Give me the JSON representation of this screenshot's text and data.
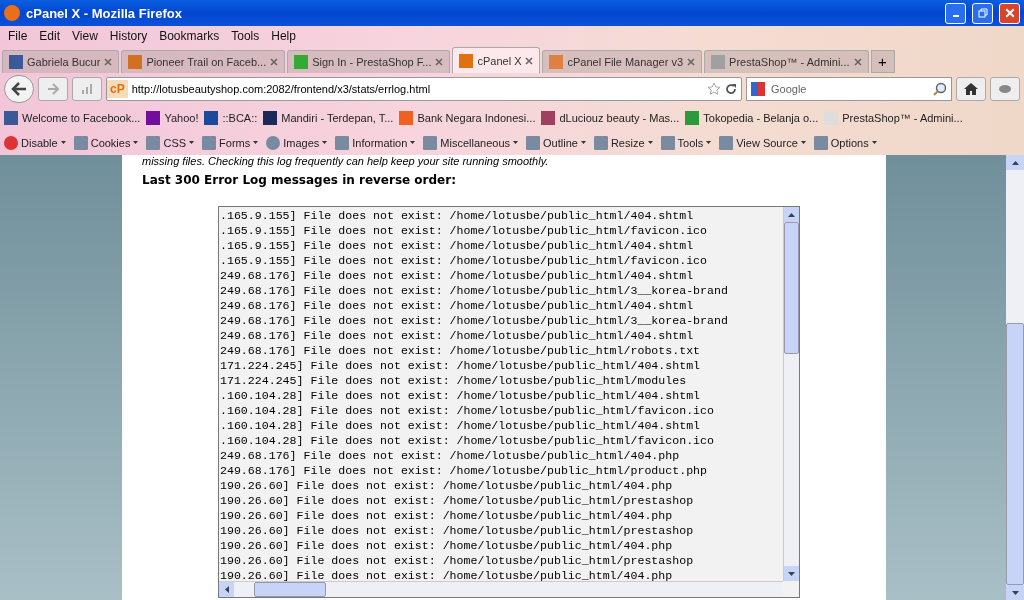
{
  "window": {
    "title": "cPanel X - Mozilla Firefox"
  },
  "menu": [
    "File",
    "Edit",
    "View",
    "History",
    "Bookmarks",
    "Tools",
    "Help"
  ],
  "tabs": [
    {
      "label": "Gabriela Bucur",
      "selected": false
    },
    {
      "label": "Pioneer Trail on Faceb...",
      "selected": false
    },
    {
      "label": "Sign In - PrestaShop F...",
      "selected": false
    },
    {
      "label": "cPanel X",
      "selected": true
    },
    {
      "label": "cPanel File Manager v3",
      "selected": false
    },
    {
      "label": "PrestaShop™ - Admini...",
      "selected": false
    }
  ],
  "new_tab": "+",
  "address": {
    "value": "http://lotusbeautyshop.com:2082/frontend/x3/stats/errlog.html",
    "badge": "cP"
  },
  "search": {
    "placeholder": "Google"
  },
  "bookmarks": [
    "Welcome to Facebook...",
    "Yahoo!",
    "::BCA::",
    "Mandiri - Terdepan, T...",
    "Bank Negara Indonesi...",
    "dLuciouz beauty - Mas...",
    "Tokopedia - Belanja o...",
    "PrestaShop™ - Admini..."
  ],
  "webdev_toolbar": [
    "Disable",
    "Cookies",
    "CSS",
    "Forms",
    "Images",
    "Information",
    "Miscellaneous",
    "Outline",
    "Resize",
    "Tools",
    "View Source",
    "Options"
  ],
  "page": {
    "intro": "missing files. Checking this log frequently can help keep your site running smoothly.",
    "heading": "Last 300 Error Log messages in reverse order:",
    "log_lines": [
      ".165.9.155] File does not exist: /home/lotusbe/public_html/404.shtml",
      ".165.9.155] File does not exist: /home/lotusbe/public_html/favicon.ico",
      ".165.9.155] File does not exist: /home/lotusbe/public_html/404.shtml",
      ".165.9.155] File does not exist: /home/lotusbe/public_html/favicon.ico",
      "249.68.176] File does not exist: /home/lotusbe/public_html/404.shtml",
      "249.68.176] File does not exist: /home/lotusbe/public_html/3__korea-brand",
      "249.68.176] File does not exist: /home/lotusbe/public_html/404.shtml",
      "249.68.176] File does not exist: /home/lotusbe/public_html/3__korea-brand",
      "249.68.176] File does not exist: /home/lotusbe/public_html/404.shtml",
      "249.68.176] File does not exist: /home/lotusbe/public_html/robots.txt",
      "171.224.245] File does not exist: /home/lotusbe/public_html/404.shtml",
      "171.224.245] File does not exist: /home/lotusbe/public_html/modules",
      ".160.104.28] File does not exist: /home/lotusbe/public_html/404.shtml",
      ".160.104.28] File does not exist: /home/lotusbe/public_html/favicon.ico",
      ".160.104.28] File does not exist: /home/lotusbe/public_html/404.shtml",
      ".160.104.28] File does not exist: /home/lotusbe/public_html/favicon.ico",
      "249.68.176] File does not exist: /home/lotusbe/public_html/404.php",
      "249.68.176] File does not exist: /home/lotusbe/public_html/product.php",
      "190.26.60] File does not exist: /home/lotusbe/public_html/404.php",
      "190.26.60] File does not exist: /home/lotusbe/public_html/prestashop",
      "190.26.60] File does not exist: /home/lotusbe/public_html/404.php",
      "190.26.60] File does not exist: /home/lotusbe/public_html/prestashop",
      "190.26.60] File does not exist: /home/lotusbe/public_html/404.php",
      "190.26.60] File does not exist: /home/lotusbe/public_html/prestashop",
      "190.26.60] File does not exist: /home/lotusbe/public_html/404.php"
    ]
  }
}
